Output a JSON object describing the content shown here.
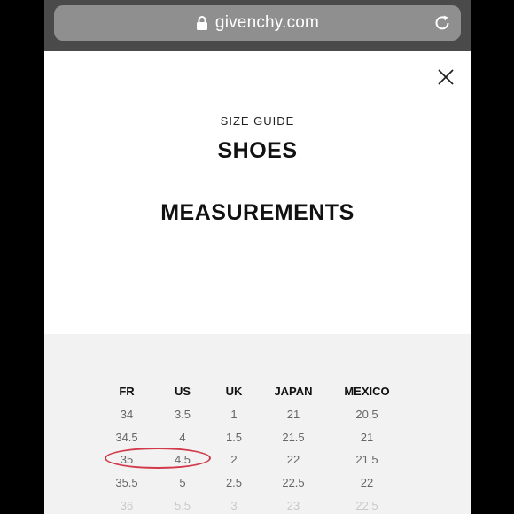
{
  "browser": {
    "url": "givenchy.com",
    "lock_icon": "lock-icon",
    "reload_icon": "reload-icon"
  },
  "modal": {
    "close_icon": "close-icon",
    "overline": "SIZE GUIDE",
    "title": "SHOES",
    "section_title": "MEASUREMENTS"
  },
  "size_table": {
    "columns": [
      "FR",
      "US",
      "UK",
      "JAPAN",
      "MEXICO"
    ],
    "rows": [
      [
        "34",
        "3.5",
        "1",
        "21",
        "20.5"
      ],
      [
        "34.5",
        "4",
        "1.5",
        "21.5",
        "21"
      ],
      [
        "35",
        "4.5",
        "2",
        "22",
        "21.5"
      ],
      [
        "35.5",
        "5",
        "2.5",
        "22.5",
        "22"
      ],
      [
        "36",
        "5.5",
        "3",
        "23",
        "22.5"
      ]
    ],
    "highlighted_row": 2,
    "highlight_color": "#d23a4b"
  }
}
